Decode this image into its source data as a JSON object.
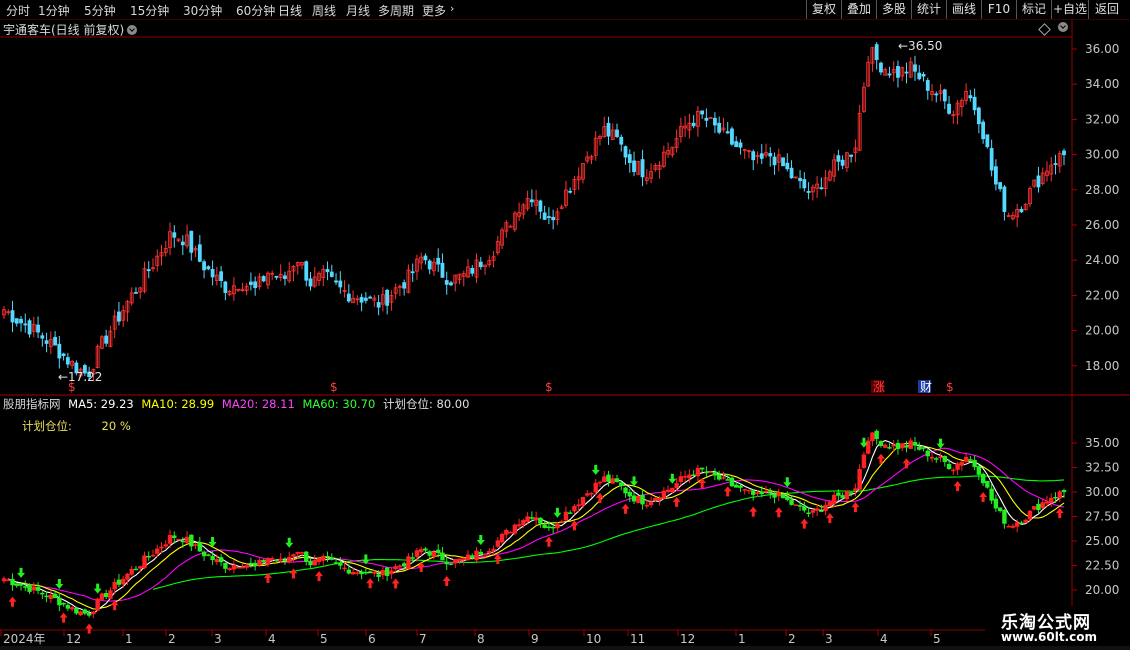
{
  "toolbar": {
    "timeframes": [
      "分时",
      "1分钟",
      "5分钟",
      "15分钟",
      "30分钟",
      "60分钟",
      "日线",
      "周线",
      "月线",
      "多周期",
      "更多"
    ],
    "active_timeframe": "日线",
    "more_chevron": "chevron-right-icon",
    "buttons": [
      "复权",
      "叠加",
      "多股",
      "统计",
      "画线",
      "F10",
      "标记",
      "+自选",
      "返回"
    ]
  },
  "stock": {
    "title": "宇通客车(日线 前复权)",
    "high_label": "36.50",
    "low_label": "17.22"
  },
  "price_axis": [
    "36.00",
    "34.00",
    "32.00",
    "30.00",
    "28.00",
    "26.00",
    "24.00",
    "22.00",
    "20.00",
    "18.00"
  ],
  "event_markers": [
    {
      "text": "$",
      "kind": "dividend",
      "color": "#ff3b3b"
    },
    {
      "text": "$",
      "kind": "dividend",
      "color": "#ff3b3b"
    },
    {
      "text": "$",
      "kind": "dividend",
      "color": "#ff3b3b"
    },
    {
      "text": "涨",
      "kind": "limit",
      "color": "#ff3b3b",
      "bg": "#5a0000"
    },
    {
      "text": "财",
      "kind": "finance",
      "color": "#ffffff",
      "bg": "#1a3aa0"
    },
    {
      "text": "$",
      "kind": "dividend",
      "color": "#ff3b3b"
    }
  ],
  "indicator": {
    "name": "股朋指标网",
    "ma5_label": "MA5: 29.23",
    "ma10_label": "MA10: 28.99",
    "ma20_label": "MA20: 28.11",
    "ma60_label": "MA60: 30.70",
    "plan_label": "计划仓位: 80.00",
    "plan_position_label": "计划仓位:",
    "plan_position_value": "20  %",
    "colors": {
      "ma5": "#ffffff",
      "ma10": "#ffff00",
      "ma20": "#ff00ff",
      "ma60": "#00ff00",
      "up": "#ff3333",
      "down": "#00ffff"
    }
  },
  "indicator_axis": [
    "35.00",
    "32.50",
    "30.00",
    "27.50",
    "25.00",
    "22.50",
    "20.00"
  ],
  "time_axis": [
    "2024年",
    "12",
    "1",
    "2",
    "3",
    "4",
    "5",
    "6",
    "7",
    "8",
    "9",
    "10",
    "11",
    "12",
    "1",
    "2",
    "3",
    "4",
    "5"
  ],
  "watermark": {
    "title": "乐淘公式网",
    "url": "www.60lt.com"
  },
  "chart_data": {
    "type": "candlestick",
    "series_note": "daily candles, price in CNY",
    "close_approx": [
      21.2,
      20.6,
      20.1,
      19.5,
      18.8,
      18.0,
      17.5,
      19.2,
      20.5,
      21.8,
      23.0,
      24.2,
      25.5,
      25.2,
      24.0,
      23.1,
      22.4,
      22.8,
      22.3,
      23.4,
      22.8,
      24.2,
      22.7,
      23.1,
      22.4,
      22.0,
      21.8,
      21.5,
      22.3,
      23.0,
      24.2,
      23.5,
      22.9,
      23.1,
      23.8,
      24.5,
      25.8,
      27.2,
      27.8,
      26.1,
      27.5,
      28.8,
      30.2,
      31.4,
      30.8,
      29.5,
      29.0,
      29.8,
      30.6,
      31.8,
      32.2,
      31.5,
      30.8,
      30.1,
      29.5,
      30.0,
      29.2,
      28.3,
      27.8,
      28.9,
      29.6,
      30.4,
      35.9,
      35.0,
      34.6,
      34.9,
      34.1,
      33.4,
      32.5,
      33.7,
      32.0,
      28.5,
      26.6,
      27.2,
      28.4,
      29.5,
      30.0
    ],
    "high": 36.5,
    "low": 17.22,
    "ylim": [
      16.5,
      37.5
    ],
    "indicator_ylim": [
      20.0,
      37.0
    ]
  }
}
